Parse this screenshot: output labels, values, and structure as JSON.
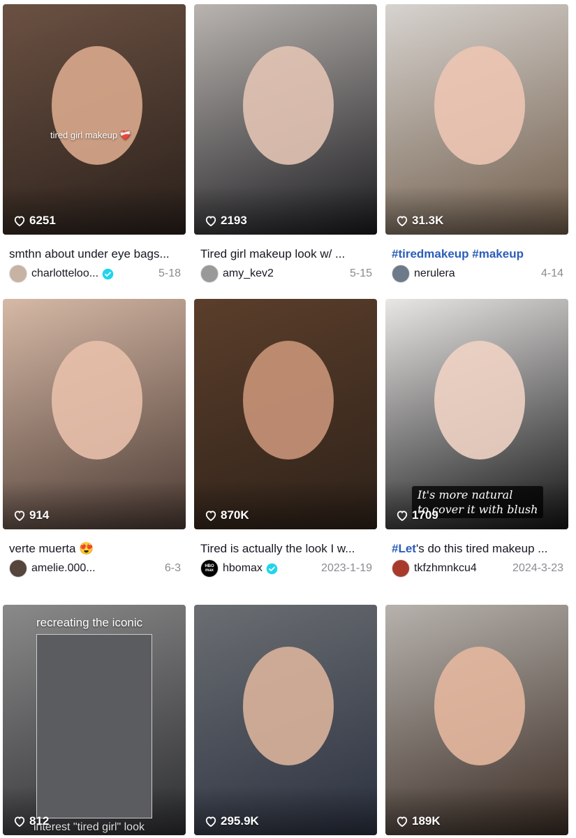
{
  "cards": [
    {
      "likes": "6251",
      "overlay": "tired girl makeup ❤️‍🩹",
      "caption": "smthn about under eye bags...",
      "user": "charlotteloo...",
      "verified": true,
      "date": "5-18",
      "bg1": "#6b5142",
      "bg2": "#2a201b",
      "skin": "#d9a98c",
      "avatar": "#c7b2a4"
    },
    {
      "likes": "2193",
      "overlay": "",
      "caption": "Tired girl makeup look w/ ...",
      "user": "amy_kev2",
      "verified": false,
      "date": "5-15",
      "bg1": "#b9b4b0",
      "bg2": "#1b1b1f",
      "skin": "#e2c3b3",
      "avatar": "#999"
    },
    {
      "likes": "31.3K",
      "overlay": "",
      "caption_tag": "#tiredmakeup #makeup",
      "caption": "",
      "user": "nerulera",
      "verified": false,
      "date": "4-14",
      "bg1": "#d7d3cf",
      "bg2": "#6f5c4a",
      "skin": "#edc5b3",
      "avatar": "#6d7a89"
    },
    {
      "likes": "914",
      "overlay": "",
      "caption": "verte muerta 😍",
      "user": "amelie.000...",
      "verified": false,
      "date": "6-3",
      "bg1": "#d6b9a6",
      "bg2": "#4b3a33",
      "skin": "#e8c0ab",
      "avatar": "#55453c"
    },
    {
      "likes": "870K",
      "overlay": "",
      "caption": "Tired is actually the look I w...",
      "user": "hbomax",
      "verified": true,
      "date": "2023-1-19",
      "bg1": "#5b3e2b",
      "bg2": "#2e2219",
      "skin": "#c89478",
      "avatar": "#000000",
      "avatar_text": "HBO max"
    },
    {
      "likes": "1709",
      "overlay_box": [
        "It's more natural",
        "to cover it with blush"
      ],
      "caption_tag": "#Let",
      "caption": "'s do this tired makeup ...",
      "user": "tkfzhmnkcu4",
      "verified": false,
      "date": "2024-3-23",
      "bg1": "#e9e7e5",
      "bg2": "#141416",
      "skin": "#f0d2c4",
      "avatar": "#a83a2c"
    },
    {
      "likes": "812",
      "overlay_top": "recreating the iconic",
      "overlay_bottom": "interest \"tired girl\" look",
      "bg1": "#8a8a8a",
      "bg2": "#2d2e31",
      "skin": "#e4c1ad"
    },
    {
      "likes": "295.9K",
      "bg1": "#6b6e72",
      "bg2": "#2b3140",
      "skin": "#d9b29b"
    },
    {
      "likes": "189K",
      "bg1": "#b7b2ad",
      "bg2": "#3a2c24",
      "skin": "#e4b79e"
    }
  ],
  "icons": {
    "heart": "heart-outline-icon",
    "verified": "verified-badge-icon"
  },
  "colors": {
    "hashtag": "#2b5db8",
    "verified": "#20d5ec",
    "date": "#8a8b91"
  }
}
